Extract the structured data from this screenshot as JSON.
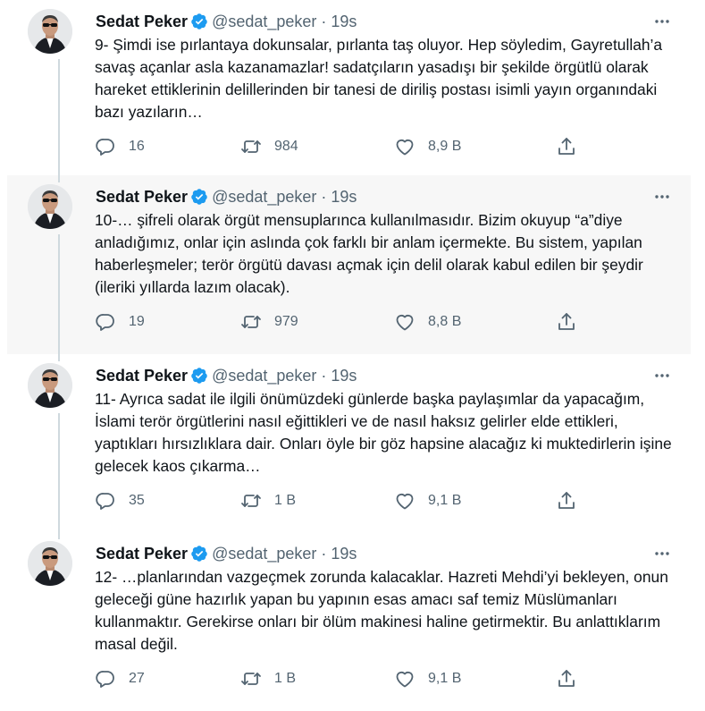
{
  "tweets": [
    {
      "name": "Sedat Peker",
      "handle": "@sedat_peker",
      "dot": "·",
      "time": "19s",
      "text": "9- Şimdi ise pırlantaya dokunsalar, pırlanta taş oluyor. Hep söyledim, Gayretullah’a savaş açanlar asla kazanamazlar! sadatçıların yasadışı bir şekilde örgütlü olarak hareket ettiklerinin delillerinden bir tanesi de diriliş postası isimli yayın organındaki bazı yazıların…",
      "replies": "16",
      "retweets": "984",
      "likes": "8,9 B"
    },
    {
      "name": "Sedat Peker",
      "handle": "@sedat_peker",
      "dot": "·",
      "time": "19s",
      "text": "10-… şifreli olarak örgüt mensuplarınca kullanılmasıdır. Bizim okuyup “a”diye anladığımız, onlar için aslında çok farklı bir anlam içermekte. Bu sistem, yapılan haberleşmeler; terör örgütü davası açmak için delil olarak kabul edilen bir şeydir (ileriki yıllarda lazım olacak).",
      "replies": "19",
      "retweets": "979",
      "likes": "8,8 B"
    },
    {
      "name": "Sedat Peker",
      "handle": "@sedat_peker",
      "dot": "·",
      "time": "19s",
      "text": "11- Ayrıca sadat ile ilgili önümüzdeki günlerde başka paylaşımlar da yapacağım, İslami terör örgütlerini nasıl eğittikleri ve de nasıl haksız gelirler elde ettikleri, yaptıkları hırsızlıklara dair. Onları öyle bir göz hapsine alacağız ki muktedirlerin işine gelecek kaos çıkarma…",
      "replies": "35",
      "retweets": "1 B",
      "likes": "9,1 B"
    },
    {
      "name": "Sedat Peker",
      "handle": "@sedat_peker",
      "dot": "·",
      "time": "19s",
      "text": "12- …planlarından vazgeçmek zorunda kalacaklar. Hazreti Mehdi’yi bekleyen, onun geleceği güne hazırlık yapan bu yapının esas amacı saf temiz Müslümanları kullanmaktır. Gerekirse onları bir ölüm makinesi haline getirmektir. Bu anlattıklarım masal değil.",
      "replies": "27",
      "retweets": "1 B",
      "likes": "9,1 B"
    }
  ],
  "icons": {
    "verified": "verified-badge-icon",
    "more": "more-dots-icon",
    "reply": "reply-icon",
    "retweet": "retweet-icon",
    "like": "heart-icon",
    "share": "share-icon"
  },
  "colors": {
    "verified": "#1d9bf0",
    "icon_gray": "#536471",
    "thread_line": "#cfd9de",
    "highlight_bg": "#f7f7f7"
  }
}
